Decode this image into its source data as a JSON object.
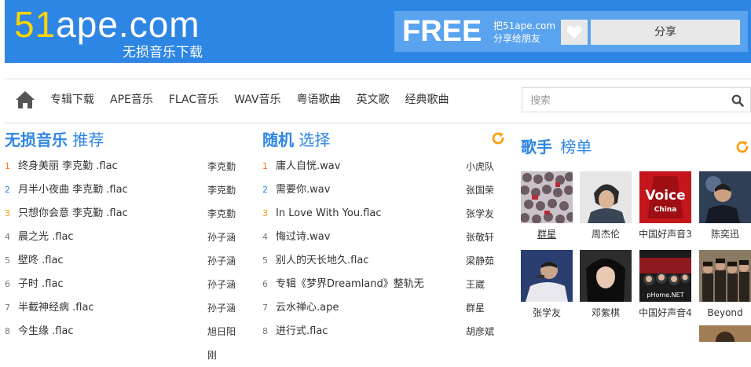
{
  "header": {
    "logo_num": "51",
    "logo_rest": "ape.com",
    "subtitle": "无损音乐下载",
    "free": "FREE",
    "share_tip_line1": "把51ape.com",
    "share_tip_line2": "分享给朋友",
    "share_label": "分享"
  },
  "nav": {
    "items": [
      "专辑下载",
      "APE音乐",
      "FLAC音乐",
      "WAV音乐",
      "粤语歌曲",
      "英文歌",
      "经典歌曲"
    ],
    "search_placeholder": "搜索"
  },
  "recommend": {
    "title_a": "无损音乐",
    "title_b": "推荐",
    "items": [
      {
        "num": "1",
        "title": "终身美丽 李克勤 .flac",
        "artist": "李克勤"
      },
      {
        "num": "2",
        "title": "月半小夜曲 李克勤 .flac",
        "artist": "李克勤"
      },
      {
        "num": "3",
        "title": "只想你会意 李克勤 .flac",
        "artist": "李克勤"
      },
      {
        "num": "4",
        "title": "晨之光 .flac",
        "artist": "孙子涵"
      },
      {
        "num": "5",
        "title": "壁咚 .flac",
        "artist": "孙子涵"
      },
      {
        "num": "6",
        "title": "子时 .flac",
        "artist": "孙子涵"
      },
      {
        "num": "7",
        "title": "半截神经病 .flac",
        "artist": "孙子涵"
      },
      {
        "num": "8",
        "title": "今生缘 .flac",
        "artist": "旭日阳刚"
      }
    ]
  },
  "random": {
    "title_a": "随机",
    "title_b": "选择",
    "items": [
      {
        "num": "1",
        "title": "庸人自恍.wav",
        "artist": "小虎队"
      },
      {
        "num": "2",
        "title": "需要你.wav",
        "artist": "张国荣"
      },
      {
        "num": "3",
        "title": "In Love With You.flac",
        "artist": "张学友"
      },
      {
        "num": "4",
        "title": "悔过诗.wav",
        "artist": "张敬轩"
      },
      {
        "num": "5",
        "title": "别人的天长地久.flac",
        "artist": "梁静茹"
      },
      {
        "num": "6",
        "title": "专辑《梦界Dreamland》整轨无",
        "artist": "王崴"
      },
      {
        "num": "7",
        "title": "云水禅心.ape",
        "artist": "群星"
      },
      {
        "num": "8",
        "title": "进行式.flac",
        "artist": "胡彦斌"
      }
    ]
  },
  "singers": {
    "title_a": "歌手",
    "title_b": "榜单",
    "items": [
      {
        "name": "群星"
      },
      {
        "name": "周杰伦"
      },
      {
        "name": "中国好声音3"
      },
      {
        "name": "陈奕迅"
      },
      {
        "name": "张学友"
      },
      {
        "name": "邓紫棋"
      },
      {
        "name": "中国好声音4"
      },
      {
        "name": "Beyond"
      }
    ]
  },
  "colors": {
    "brand": "#2e86e4",
    "logo_accent": "#ffd400",
    "refresh": "#ff9a00"
  }
}
